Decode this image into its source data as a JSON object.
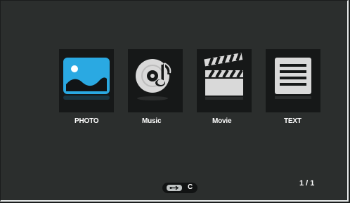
{
  "menu": [
    {
      "label": "PHOTO",
      "icon": "photo-icon"
    },
    {
      "label": "Music",
      "icon": "music-icon"
    },
    {
      "label": "Movie",
      "icon": "movie-clapper-icon"
    },
    {
      "label": "TEXT",
      "icon": "text-document-icon"
    }
  ],
  "selected": "PHOTO",
  "source": {
    "icon": "usb-icon",
    "drive": "C"
  },
  "pagination": "1 / 1",
  "colors": {
    "accent": "#29a8e0",
    "background": "#2b2e2d",
    "tile": "#161818"
  }
}
